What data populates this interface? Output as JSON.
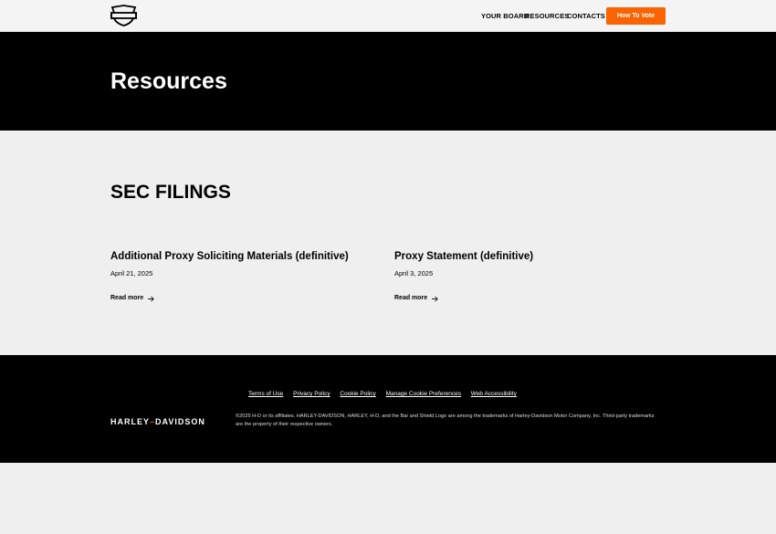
{
  "header": {
    "logo_icon": "bar-and-shield-icon",
    "nav": [
      "YOUR BOARD",
      "RESOURCES",
      "CONTACTS"
    ],
    "cta_label": "How To Vote",
    "accent_color": "#f96302"
  },
  "hero": {
    "title": "Resources"
  },
  "main": {
    "section_title": "SEC FILINGS",
    "cards": [
      {
        "title": "Additional Proxy Soliciting Materials (definitive)",
        "date": "April 21, 2025",
        "link": "Read more"
      },
      {
        "title": "Proxy Statement (definitive)",
        "date": "April 3, 2025",
        "link": "Read more"
      }
    ]
  },
  "footer": {
    "links": [
      "Terms of Use",
      "Privacy Policy",
      "Cookie Policy",
      "Manage Cookie Preferences",
      "Web Accessibility"
    ],
    "wordmark_left": "HARLEY",
    "wordmark_dash": "–",
    "wordmark_right": "DAVIDSON",
    "copyright": "©2025 H-D or its affiliates. HARLEY-DAVIDSON, HARLEY, H-D, and the Bar and Shield Logo are among the trademarks of Harley-Davidson Motor Company, Inc. Third-party trademarks are the property of their respective owners."
  }
}
